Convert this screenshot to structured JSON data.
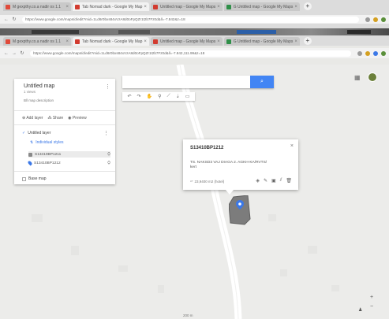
{
  "browser_back": {
    "tabs": [
      {
        "label": "M  gexpthy.co.a nadir os 1.1"
      },
      {
        "label": "Tab Nomad dark - Google My Map"
      },
      {
        "label": "Untitled map - Google My Maps"
      },
      {
        "label": "G  Untitled map - Google My Maps"
      }
    ],
    "url": "https://www.google.com/maps/d/edit?mid=1Ld6r0bxs84xVzA8d0oFpQZr1t2b7Fz0d&ll=-7.842&z=18"
  },
  "browser": {
    "tabs": [
      {
        "label": "M  gexpthy.co.a nadir os 1.1"
      },
      {
        "label": "Tab Nomad dark - Google My Map"
      },
      {
        "label": "Untitled map - Google My Maps"
      },
      {
        "label": "G  Untitled map - Google My Maps"
      }
    ],
    "url": "https://www.google.com/maps/d/edit?mid=1Ld6r0bxs84xVzA8d0oFpQZr1t2b7Fz0d&ll=-7.842,111.99&z=18"
  },
  "panel": {
    "title": "Untitled map",
    "subtitle": "1 views",
    "description": "Bll map description",
    "actions": [
      "Add layer",
      "Share",
      "Preview"
    ],
    "layer_name": "Untitled layer",
    "layer_link": "Individual styles",
    "items": [
      {
        "label": "S13410BP1211",
        "selected": true
      },
      {
        "label": "S13410BP1212",
        "selected": false
      }
    ],
    "basemap": "Base map"
  },
  "search": {
    "placeholder": "",
    "button_icon": "search-icon"
  },
  "toolbar": {
    "icons": [
      "undo-icon",
      "redo-icon",
      "hand-icon",
      "marker-icon",
      "line-icon",
      "route-icon",
      "ruler-icon"
    ]
  },
  "popup": {
    "title": "S13410BP1212",
    "description": "TS. NAKSD3 VAJ DIAGA 2. AGKH-KA/RVTS/ kert",
    "footer": "23,9400 m2 (hotel)",
    "icons": [
      "paint-icon",
      "edit-icon",
      "camera-icon",
      "filter-icon",
      "delete-icon"
    ]
  },
  "map": {
    "scale": "200 m",
    "zoom_in": "+",
    "zoom_out": "−"
  },
  "colors": {
    "accent": "#4285f4",
    "marker": "#3b78e7",
    "parcel": "#7c7c7c"
  }
}
